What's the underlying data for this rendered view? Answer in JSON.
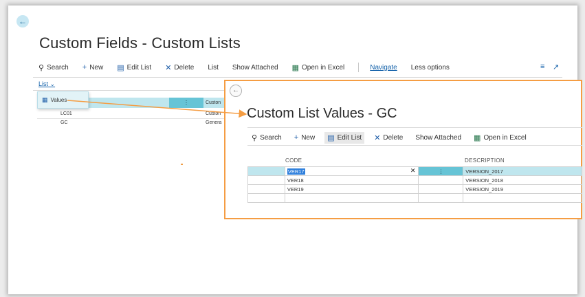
{
  "main": {
    "title": "Custom Fields - Custom Lists",
    "toolbar": {
      "search": "Search",
      "new": "New",
      "edit_list": "Edit List",
      "delete": "Delete",
      "list": "List",
      "show_attached": "Show Attached",
      "open_in_excel": "Open in Excel",
      "navigate": "Navigate",
      "less_options": "Less options"
    },
    "list_tab": "List",
    "values_action": "Values",
    "rows": [
      {
        "code": "",
        "desc": "Custon"
      },
      {
        "code": "LC01",
        "desc": "Custon"
      },
      {
        "code": "GC",
        "desc": "Genera"
      }
    ]
  },
  "overlay": {
    "title": "Custom List Values - GC",
    "toolbar": {
      "search": "Search",
      "new": "New",
      "edit_list": "Edit List",
      "delete": "Delete",
      "show_attached": "Show Attached",
      "open_in_excel": "Open in Excel"
    },
    "columns": {
      "code": "CODE",
      "description": "DESCRIPTION"
    },
    "rows": [
      {
        "code": "VER17",
        "description": "VERSION_2017"
      },
      {
        "code": "VER18",
        "description": "VERSION_2018"
      },
      {
        "code": "VER19",
        "description": "VERSION_2019"
      },
      {
        "code": "",
        "description": ""
      }
    ]
  },
  "colors": {
    "accent": "#1160a9",
    "highlight": "#bfe6ee",
    "annotation": "#f59d43"
  }
}
